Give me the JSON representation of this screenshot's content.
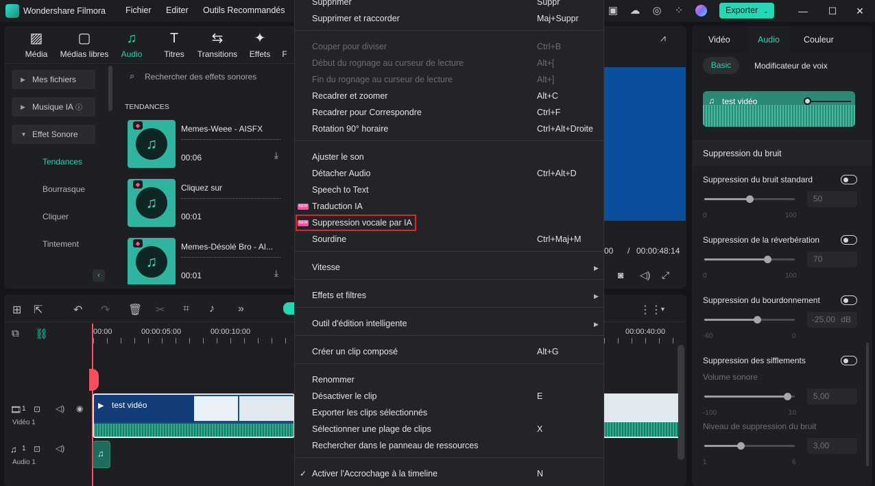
{
  "app": {
    "title": "Wondershare Filmora",
    "menu": [
      "Fichier",
      "Editer",
      "Outils Recommandés"
    ],
    "export": "Exporter"
  },
  "media_tabs": [
    {
      "label": "Média",
      "icon": "media-icon"
    },
    {
      "label": "Médias libres",
      "icon": "stock-media-icon"
    },
    {
      "label": "Audio",
      "icon": "music-note-icon"
    },
    {
      "label": "Titres",
      "icon": "title-icon"
    },
    {
      "label": "Transitions",
      "icon": "transition-icon"
    },
    {
      "label": "Effets",
      "icon": "effects-icon"
    },
    {
      "label": "F"
    }
  ],
  "sidebar": {
    "items": [
      "Mes fichiers",
      "Musique IA",
      "Effet Sonore"
    ],
    "subitems": [
      "Tendances",
      "Bourrasque",
      "Cliquer",
      "Tintement"
    ]
  },
  "search": {
    "placeholder": "Rechercher des effets sonores"
  },
  "library": {
    "section": "TENDANCES",
    "cards": [
      {
        "name": "Memes-Weee - AISFX",
        "duration": "00:06"
      },
      {
        "name": "Cliquez sur",
        "duration": "00:01"
      },
      {
        "name": "Memes-Désolé Bro - AI...",
        "duration": "00:01"
      }
    ]
  },
  "context_menu": {
    "items": [
      {
        "label": "Supprimer",
        "shortcut": "Suppr",
        "disabled": false
      },
      {
        "label": "Supprimer et raccorder",
        "shortcut": "Maj+Suppr",
        "disabled": false
      },
      {
        "label": "Couper pour diviser",
        "shortcut": "Ctrl+B",
        "disabled": true
      },
      {
        "label": "Début du rognage au curseur de lecture",
        "shortcut": "Alt+[",
        "disabled": true
      },
      {
        "label": "Fin du rognage au curseur de lecture",
        "shortcut": "Alt+]",
        "disabled": true
      },
      {
        "label": "Recadrer et zoomer",
        "shortcut": "Alt+C",
        "disabled": false
      },
      {
        "label": "Recadrer pour Correspondre",
        "shortcut": "Ctrl+F",
        "disabled": false
      },
      {
        "label": "Rotation 90° horaire",
        "shortcut": "Ctrl+Alt+Droite",
        "disabled": false
      },
      {
        "label": "Ajuster le son",
        "shortcut": "",
        "disabled": false
      },
      {
        "label": "Détacher Audio",
        "shortcut": "Ctrl+Alt+D",
        "disabled": false
      },
      {
        "label": "Speech to Text",
        "shortcut": "",
        "disabled": false
      },
      {
        "label": "Traduction IA",
        "shortcut": "",
        "disabled": false,
        "new": true
      },
      {
        "label": "Suppression vocale par IA",
        "shortcut": "",
        "disabled": false,
        "new": true,
        "highlighted": true
      },
      {
        "label": "Sourdine",
        "shortcut": "Ctrl+Maj+M",
        "disabled": false
      },
      {
        "label": "Vitesse",
        "shortcut": "",
        "submenu": true
      },
      {
        "label": "Effets et filtres",
        "shortcut": "",
        "submenu": true
      },
      {
        "label": "Outil d'édition intelligente",
        "shortcut": "",
        "submenu": true
      },
      {
        "label": "Créer un clip composé",
        "shortcut": "Alt+G"
      },
      {
        "label": "Renommer",
        "shortcut": ""
      },
      {
        "label": "Désactiver le clip",
        "shortcut": "E"
      },
      {
        "label": "Exporter les clips sélectionnés",
        "shortcut": ""
      },
      {
        "label": "Sélectionner une plage de clips",
        "shortcut": "X"
      },
      {
        "label": "Rechercher dans le panneau de ressources",
        "shortcut": ""
      },
      {
        "label": "Activer l'Accrochage à la timeline",
        "shortcut": "N",
        "checked": true
      }
    ]
  },
  "preview": {
    "time_current": "00",
    "time_total": "00:00:48:14"
  },
  "timeline": {
    "ruler": [
      "00:00",
      "00:00:05:00",
      "00:00:10:00",
      "00:00:40:00"
    ],
    "tracks": [
      {
        "label": "Vidéo 1",
        "num": "1"
      },
      {
        "label": "Audio 1",
        "num": "1"
      }
    ],
    "clip_name": "test vidéo"
  },
  "right_panel": {
    "tabs": [
      "Vidéo",
      "Audio",
      "Couleur"
    ],
    "active_tab": "Audio",
    "subtabs": [
      "Basic",
      "Modificateur de voix"
    ],
    "clip_name": "test vidéo",
    "section": "Suppression du bruit",
    "controls": [
      {
        "label": "Suppression du bruit standard",
        "value": "50",
        "min": "0",
        "max": "100",
        "level": 0.5
      },
      {
        "label": "Suppression de la réverbération",
        "value": "70",
        "min": "0",
        "max": "100",
        "level": 0.7
      },
      {
        "label": "Suppression du bourdonnement",
        "value": "-25,00",
        "unit": "dB",
        "min": "-60",
        "max": "0",
        "level": 0.58
      },
      {
        "label": "Suppression des sifflements",
        "sub": "Volume sonore",
        "value": "5,00",
        "min": "-100",
        "max": "10",
        "level": 0.92
      },
      {
        "label": "",
        "sub": "Niveau de suppression du bruit",
        "value": "3,00",
        "min": "1",
        "max": "6",
        "level": 0.4
      }
    ]
  },
  "colors": {
    "accent": "#22d8b5",
    "highlight_border": "#e0262b",
    "new_tag": "#ff4fa3",
    "preview_blue": "#0b4f9c",
    "playhead": "#ff4d5e"
  }
}
